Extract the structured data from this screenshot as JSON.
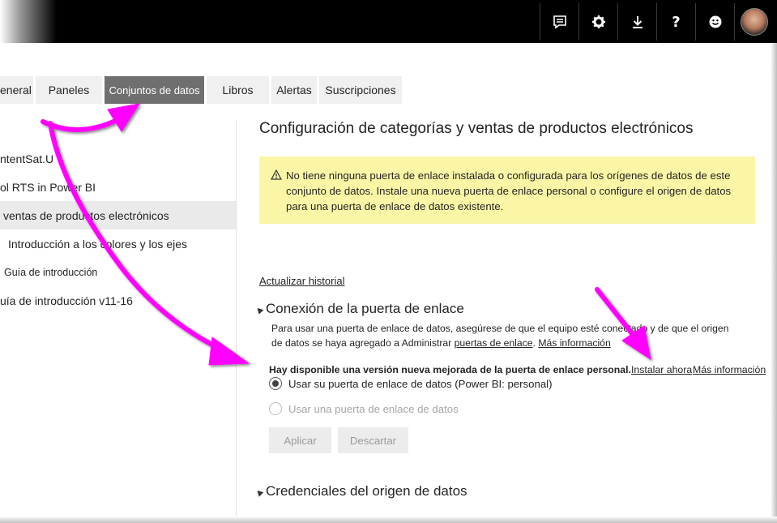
{
  "topbar": {
    "icons": [
      {
        "name": "feedback-icon",
        "glyph": "▤"
      },
      {
        "name": "gear-icon",
        "glyph": "⚙"
      },
      {
        "name": "download-icon",
        "glyph": "⭳"
      },
      {
        "name": "help-icon",
        "glyph": "?"
      },
      {
        "name": "smiley-icon",
        "glyph": "☺"
      }
    ],
    "help_label": "?"
  },
  "tabs": [
    {
      "label": "eneral"
    },
    {
      "label": "Paneles"
    },
    {
      "label": "Conjuntos de datos"
    },
    {
      "label": "Libros"
    },
    {
      "label": "Alertas"
    },
    {
      "label": "Suscripciones"
    }
  ],
  "left_list": [
    {
      "label": "ntentSat.U"
    },
    {
      "label": "ol RTS in Power BI"
    },
    {
      "label": "ventas de productos electrónicos"
    },
    {
      "label": "Introducción a los colores y los ejes"
    },
    {
      "label": "Guía de introducción"
    },
    {
      "label": "uía de introducción v11-16"
    }
  ],
  "main": {
    "title": "Configuración de categorías y ventas de productos electrónicos",
    "warning": "No tiene ninguna puerta de enlace instalada o configurada para los orígenes de datos de este conjunto de datos. Instale una nueva puerta de enlace personal o configure el origen de datos para una puerta de enlace de datos existente.",
    "history_link": "Actualizar historial",
    "gateway_section": "Conexión de la puerta de enlace",
    "gateway_desc_1": "Para usar una puerta de enlace de datos, asegúrese de que el equipo esté conectado y de que el origen de datos se haya agregado a Administrar ",
    "gateway_desc_link": "puertas de enlace",
    "gateway_desc_2": ". ",
    "gateway_more_info": "Más información",
    "new_version_text": "Hay disponible una versión nueva mejorada de la puerta de enlace personal.",
    "install_now": "Instalar ahora",
    "more_info": "Más información",
    "radio_personal": "Usar su puerta de enlace de datos (Power BI: personal)",
    "radio_gateway": "Usar una puerta de enlace de datos",
    "apply_button": "Aplicar",
    "discard_button": "Descartar",
    "credentials_section": "Credenciales del origen de datos"
  },
  "colors": {
    "topbar": "#000000",
    "active_tab": "#6f6f6f",
    "warning_bg": "#fbf6a6",
    "annotation_arrow": "#ff00ff"
  }
}
